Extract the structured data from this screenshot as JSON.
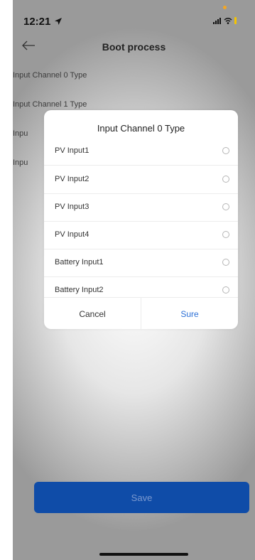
{
  "status_bar": {
    "time": "12:21"
  },
  "header": {
    "title": "Boot process"
  },
  "background_list": {
    "items": [
      {
        "label": "Input Channel 0 Type"
      },
      {
        "label": "Input Channel 1 Type"
      },
      {
        "label": "Inpu"
      },
      {
        "label": "Inpu"
      }
    ]
  },
  "dialog": {
    "title": "Input Channel 0 Type",
    "options": [
      {
        "label": "PV Input1",
        "selected": false
      },
      {
        "label": "PV Input2",
        "selected": false
      },
      {
        "label": "PV Input3",
        "selected": false
      },
      {
        "label": "PV Input4",
        "selected": false
      },
      {
        "label": "Battery Input1",
        "selected": false
      },
      {
        "label": "Battery Input2",
        "selected": false
      }
    ],
    "cancel_label": "Cancel",
    "confirm_label": "Sure"
  },
  "footer": {
    "save_label": "Save"
  },
  "colors": {
    "primary_button": "#0f4ca8",
    "link_blue": "#2b6fd6",
    "status_dot": "#f5a623"
  }
}
